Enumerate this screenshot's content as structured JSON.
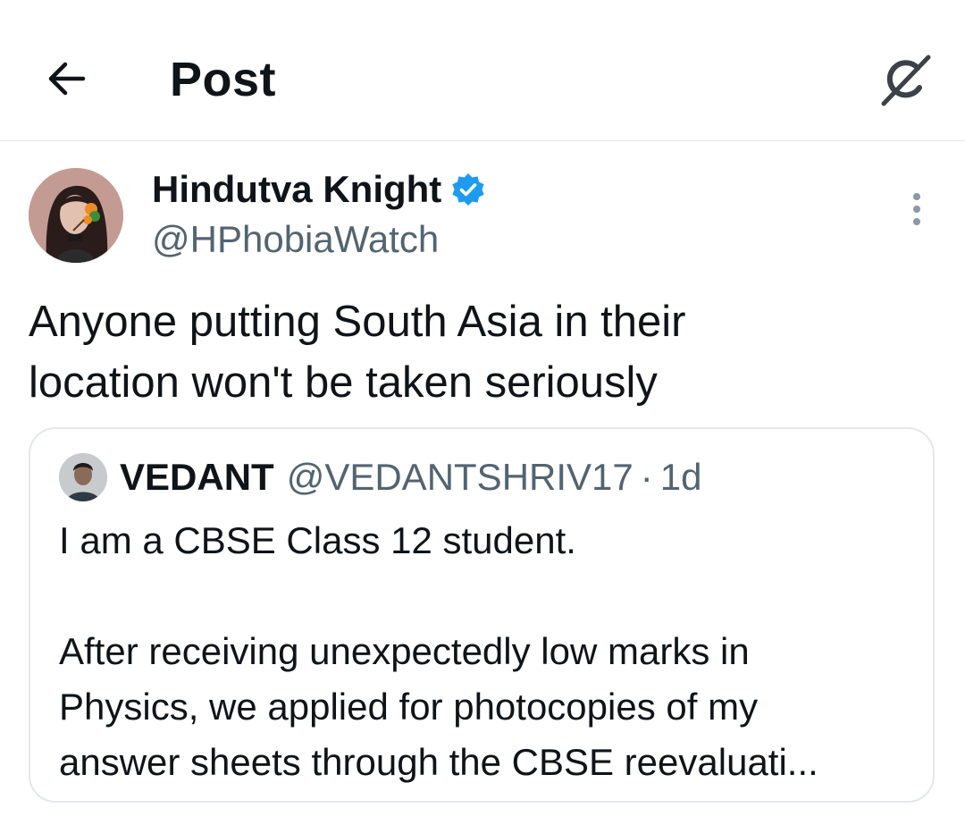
{
  "header": {
    "title": "Post",
    "back_icon": "arrow-left-icon",
    "grok_icon": "grok-icon"
  },
  "author": {
    "name": "Hindutva Knight",
    "handle": "@HPhobiaWatch",
    "verified": true,
    "verified_color": "#1d9bf0"
  },
  "post": {
    "lines": [
      "Anyone putting South Asia in their",
      "location won't be taken seriously"
    ]
  },
  "quote": {
    "name": "VEDANT",
    "handle": "@VEDANTSHRIV17",
    "separator": "·",
    "time": "1d",
    "paragraph1": "I am a CBSE Class 12 student.",
    "paragraph2_lines": [
      "After receiving unexpectedly low marks in",
      "Physics, we applied for photocopies of my",
      "answer sheets through the CBSE reevaluati..."
    ]
  },
  "colors": {
    "text": "#0f1419",
    "secondary": "#536471",
    "border": "#e4e8eb"
  }
}
